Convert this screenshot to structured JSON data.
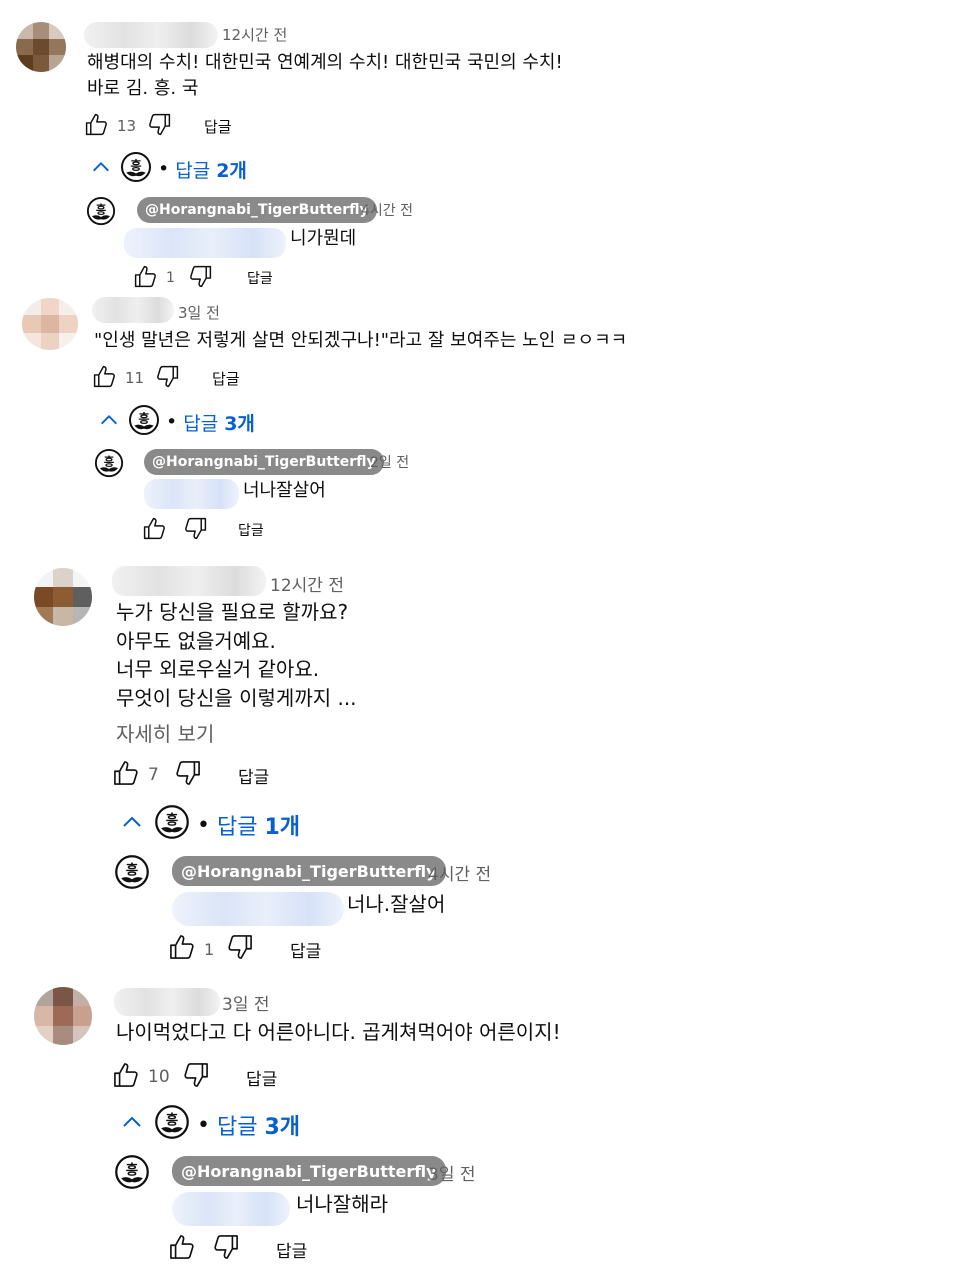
{
  "reply_label": "답글",
  "threads": [
    {
      "time": "12시간 전",
      "lines": [
        "해병대의 수치! 대한민국 연예계의 수치! 대한민국 국민의 수치!",
        "바로 김. 흥. 국"
      ],
      "likes": "13",
      "replies_toggle": {
        "prefix": "답글",
        "count": "2개"
      },
      "reply": {
        "handle": "@Horangnabi_TigerButterfly",
        "time": "4시간 전",
        "text": "니가뭔데",
        "likes": "1"
      }
    },
    {
      "time": "3일 전",
      "lines": [
        "\"인생 말년은 저렇게 살면 안되겠구나!\"라고 잘 보여주는 노인 ㄹㅇㅋㅋ"
      ],
      "likes": "11",
      "replies_toggle": {
        "prefix": "답글",
        "count": "3개"
      },
      "reply": {
        "handle": "@Horangnabi_TigerButterfly",
        "time": "2일 전",
        "text": "너나잘살어",
        "likes": ""
      }
    },
    {
      "time": "12시간 전",
      "lines": [
        "누가 당신을 필요로 할까요?",
        "아무도 없을거예요.",
        "너무 외로우실거 같아요.",
        "무엇이 당신을 이렇게까지 ..."
      ],
      "read_more": "자세히 보기",
      "likes": "7",
      "replies_toggle": {
        "prefix": "답글",
        "count": "1개"
      },
      "reply": {
        "handle": "@Horangnabi_TigerButterfly",
        "time": "4시간 전",
        "text": "너나.잘살어",
        "likes": "1"
      }
    },
    {
      "time": "3일 전",
      "lines": [
        "나이먹었다고 다 어른아니다. 곱게쳐먹어야 어른이지!"
      ],
      "likes": "10",
      "replies_toggle": {
        "prefix": "답글",
        "count": "3개"
      },
      "reply": {
        "handle": "@Horangnabi_TigerButterfly",
        "time": "3일 전",
        "text": "너나잘해라",
        "likes": ""
      }
    }
  ],
  "icons": {
    "like": "thumb-up-icon",
    "dislike": "thumb-down-icon",
    "collapse": "chevron-up-icon",
    "channel_avatar": "heung-emblem-icon"
  }
}
